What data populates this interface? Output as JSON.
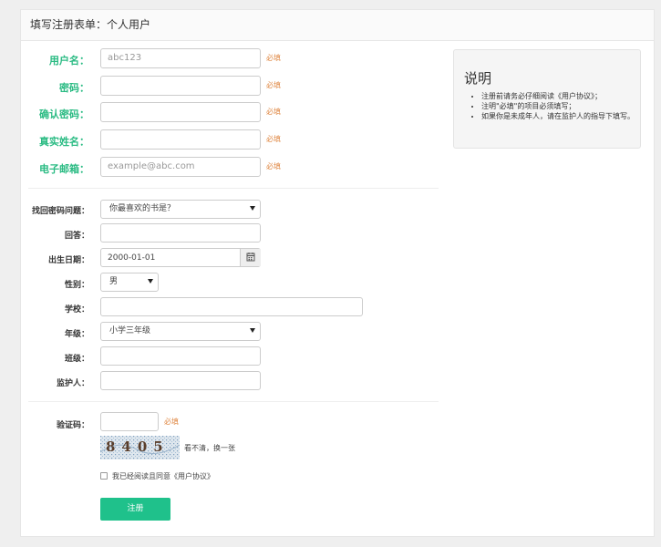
{
  "header": {
    "title": "填写注册表单：个人用户"
  },
  "required_text": "必填",
  "section1": {
    "username": {
      "label": "用户名：",
      "value": "abc123"
    },
    "password": {
      "label": "密码："
    },
    "confirm_password": {
      "label": "确认密码："
    },
    "real_name": {
      "label": "真实姓名："
    },
    "email": {
      "label": "电子邮箱：",
      "placeholder": "example@abc.com"
    }
  },
  "section2": {
    "security_question": {
      "label": "找回密码问题：",
      "value": "你最喜欢的书是？"
    },
    "answer": {
      "label": "回答："
    },
    "birthdate": {
      "label": "出生日期：",
      "value": "2000-01-01"
    },
    "gender": {
      "label": "性别：",
      "value": "男"
    },
    "school": {
      "label": "学校："
    },
    "grade": {
      "label": "年级：",
      "value": "小学三年级"
    },
    "class": {
      "label": "班级："
    },
    "guardian": {
      "label": "监护人："
    }
  },
  "section3": {
    "captcha": {
      "label": "验证码：",
      "image_text": "8405",
      "refresh_text": "看不清，换一张"
    },
    "agree_text": "我已经阅读且同意《用户协议》",
    "submit_label": "注册"
  },
  "sidebar": {
    "title": "说明",
    "notes": [
      "注册前请务必仔细阅读《用户协议》；",
      "注明\"必填\"的项目必须填写；",
      "如果你是未成年人，请在监护人的指导下填写。"
    ]
  },
  "colors": {
    "accent": "#1fc18b",
    "label_green": "#2abb83",
    "required": "#e08a47"
  },
  "icons": {
    "calendar": "calendar-icon",
    "caret": "caret-down-icon"
  }
}
